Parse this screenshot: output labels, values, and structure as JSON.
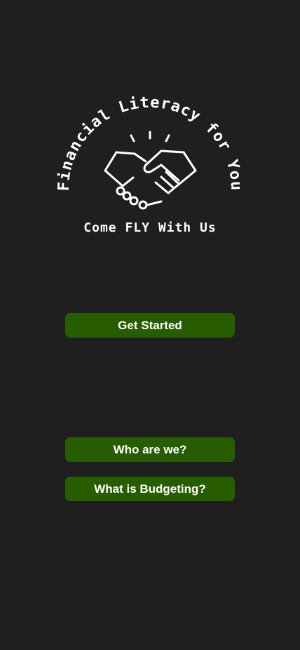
{
  "logo": {
    "arc_text": "Financial Literacy for You",
    "tagline": "Come FLY With Us",
    "icon": "handshake-icon"
  },
  "buttons": {
    "get_started": "Get Started",
    "who_are_we": "Who are we?",
    "what_is_budgeting": "What is Budgeting?"
  },
  "colors": {
    "background": "#1f1f1f",
    "button": "#285c00",
    "text": "#ffffff"
  }
}
